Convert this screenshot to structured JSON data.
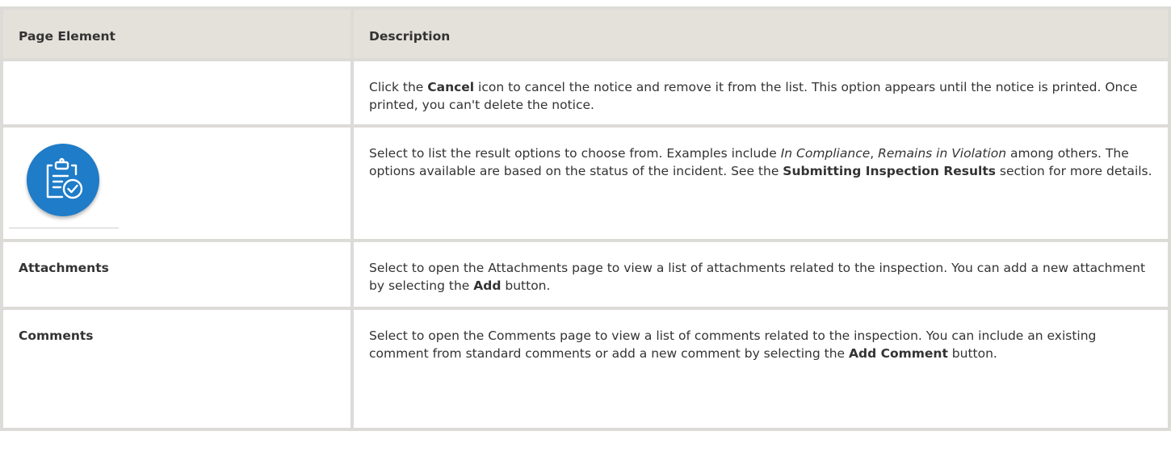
{
  "headers": {
    "element": "Page Element",
    "description": "Description"
  },
  "rows": {
    "cancel": {
      "element": "",
      "desc": {
        "t1": "Click the ",
        "b1": "Cancel",
        "t2": " icon to cancel the notice and remove it from the list. This option appears until the notice is printed. Once printed, you can't delete the notice."
      }
    },
    "result": {
      "icon": "clipboard-check-icon",
      "icon_color": "#1e7cc8",
      "desc": {
        "t1": "Select to list the result options to choose from. Examples include ",
        "i1": "In Compliance",
        "t2": ", ",
        "i2": "Remains in Violation",
        "t3": " among others. The options available are based on the status of the incident. See the ",
        "b1": "Submitting Inspection Results",
        "t4": " section for more details."
      }
    },
    "attachments": {
      "element": "Attachments",
      "desc": {
        "t1": "Select to open the Attachments page to view a list of attachments related to the inspection. You can add a new attachment by selecting the ",
        "b1": "Add",
        "t2": " button."
      }
    },
    "comments": {
      "element": "Comments",
      "desc": {
        "t1": "Select to open the Comments page to view a list of comments related to the inspection. You can include an existing comment from standard comments or add a new comment by selecting the ",
        "b1": "Add Comment",
        "t2": " button."
      }
    }
  }
}
